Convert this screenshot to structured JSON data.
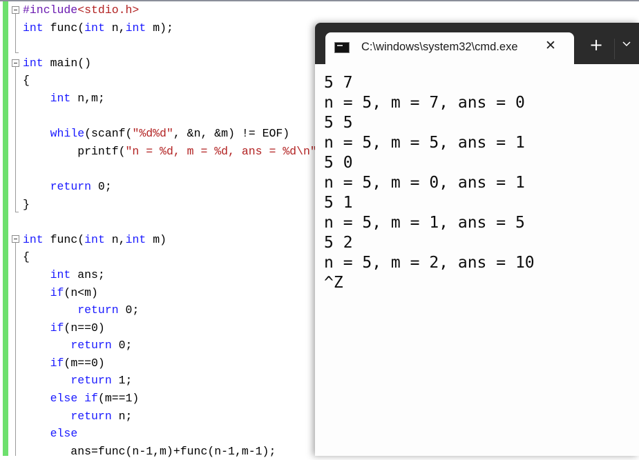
{
  "editor": {
    "lines": [
      [
        [
          "pp",
          "#include"
        ],
        [
          "inc",
          "<stdio.h>"
        ]
      ],
      [
        [
          "kw",
          "int"
        ],
        [
          "t",
          " func("
        ],
        [
          "kw",
          "int"
        ],
        [
          "t",
          " n,"
        ],
        [
          "kw",
          "int"
        ],
        [
          "t",
          " m);"
        ]
      ],
      [],
      [
        [
          "kw",
          "int"
        ],
        [
          "t",
          " main()"
        ]
      ],
      [
        [
          "t",
          "{"
        ]
      ],
      [
        [
          "t",
          "    "
        ],
        [
          "kw",
          "int"
        ],
        [
          "t",
          " n,m;"
        ]
      ],
      [],
      [
        [
          "t",
          "    "
        ],
        [
          "kw",
          "while"
        ],
        [
          "t",
          "(scanf("
        ],
        [
          "str",
          "\"%d%d\""
        ],
        [
          "t",
          ", &n, &m) != EOF)"
        ]
      ],
      [
        [
          "t",
          "        printf("
        ],
        [
          "str",
          "\"n = %d, m = %d, ans = %d\\n\""
        ]
      ],
      [],
      [
        [
          "t",
          "    "
        ],
        [
          "kw",
          "return"
        ],
        [
          "t",
          " 0;"
        ]
      ],
      [
        [
          "t",
          "}"
        ]
      ],
      [],
      [
        [
          "kw",
          "int"
        ],
        [
          "t",
          " func("
        ],
        [
          "kw",
          "int"
        ],
        [
          "t",
          " n,"
        ],
        [
          "kw",
          "int"
        ],
        [
          "t",
          " m)"
        ]
      ],
      [
        [
          "t",
          "{"
        ]
      ],
      [
        [
          "t",
          "    "
        ],
        [
          "kw",
          "int"
        ],
        [
          "t",
          " ans;"
        ]
      ],
      [
        [
          "t",
          "    "
        ],
        [
          "kw",
          "if"
        ],
        [
          "t",
          "(n<m)"
        ]
      ],
      [
        [
          "t",
          "        "
        ],
        [
          "kw",
          "return"
        ],
        [
          "t",
          " 0;"
        ]
      ],
      [
        [
          "t",
          "    "
        ],
        [
          "kw",
          "if"
        ],
        [
          "t",
          "(n==0)"
        ]
      ],
      [
        [
          "t",
          "       "
        ],
        [
          "kw",
          "return"
        ],
        [
          "t",
          " 0;"
        ]
      ],
      [
        [
          "t",
          "    "
        ],
        [
          "kw",
          "if"
        ],
        [
          "t",
          "(m==0)"
        ]
      ],
      [
        [
          "t",
          "       "
        ],
        [
          "kw",
          "return"
        ],
        [
          "t",
          " 1;"
        ]
      ],
      [
        [
          "t",
          "    "
        ],
        [
          "kw",
          "else if"
        ],
        [
          "t",
          "(m==1)"
        ]
      ],
      [
        [
          "t",
          "       "
        ],
        [
          "kw",
          "return"
        ],
        [
          "t",
          " n;"
        ]
      ],
      [
        [
          "t",
          "    "
        ],
        [
          "kw",
          "else"
        ]
      ],
      [
        [
          "t",
          "       ans=func(n-1,m)+func(n-1,m-1);"
        ]
      ]
    ]
  },
  "terminal": {
    "tab_title": "C:\\windows\\system32\\cmd.exe",
    "tab_icon": "console-icon",
    "close_glyph": "✕",
    "new_tab_glyph": "+",
    "output": [
      "5 7",
      "n = 5, m = 7, ans = 0",
      "5 5",
      "n = 5, m = 5, ans = 1",
      "5 0",
      "n = 5, m = 0, ans = 1",
      "5 1",
      "n = 5, m = 1, ans = 5",
      "5 2",
      "n = 5, m = 2, ans = 10",
      "^Z"
    ]
  }
}
